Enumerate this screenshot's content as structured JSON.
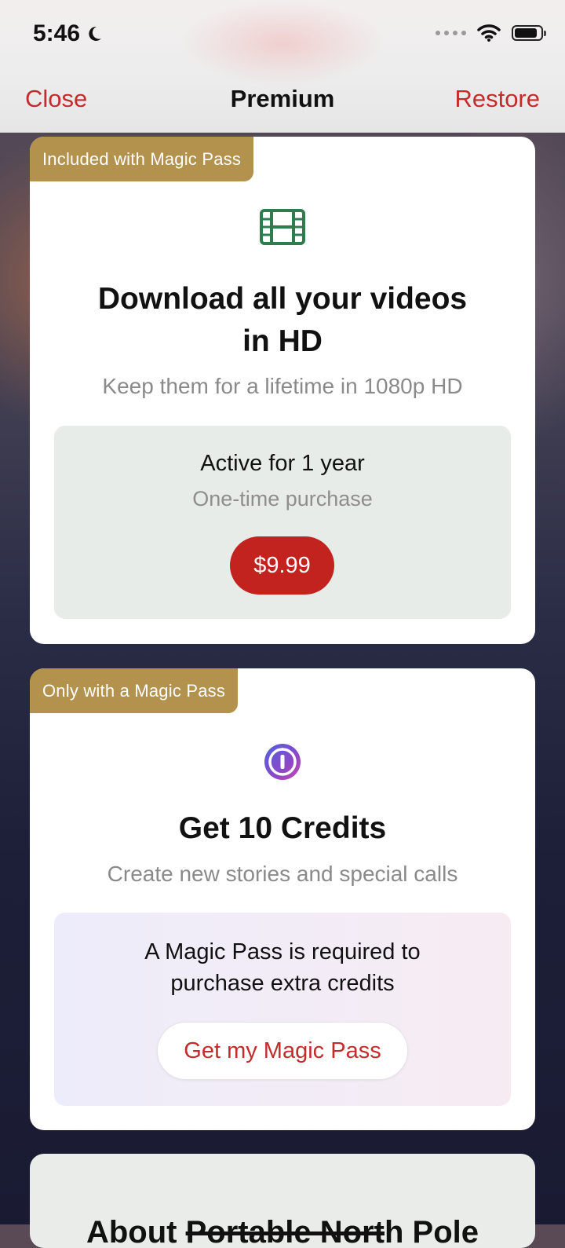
{
  "status_bar": {
    "time": "5:46"
  },
  "nav": {
    "close_label": "Close",
    "title": "Premium",
    "restore_label": "Restore"
  },
  "card_hd": {
    "badge": "Included with Magic Pass",
    "icon": "film-icon",
    "title_line1": "Download all your videos",
    "title_line2": "in HD",
    "subtitle": "Keep them for a lifetime in 1080p HD",
    "offer_title": "Active for 1 year",
    "offer_sub": "One-time purchase",
    "price_label": "$9.99"
  },
  "card_credits": {
    "badge": "Only with a Magic Pass",
    "icon": "credit-coin-icon",
    "title": "Get 10 Credits",
    "subtitle": "Create new stories and special calls",
    "notice_line1": "A Magic Pass is required to",
    "notice_line2": "purchase extra credits",
    "button_label": "Get my Magic Pass"
  },
  "card_about": {
    "title_pre": "About ",
    "title_struck": "Portable Nort",
    "title_post": "h Pole"
  },
  "colors": {
    "accent_red": "#c42b2b",
    "badge_gold": "#b3924d",
    "film_icon_green": "#2f7d4f",
    "coin_purple": "#7a4fd0"
  }
}
